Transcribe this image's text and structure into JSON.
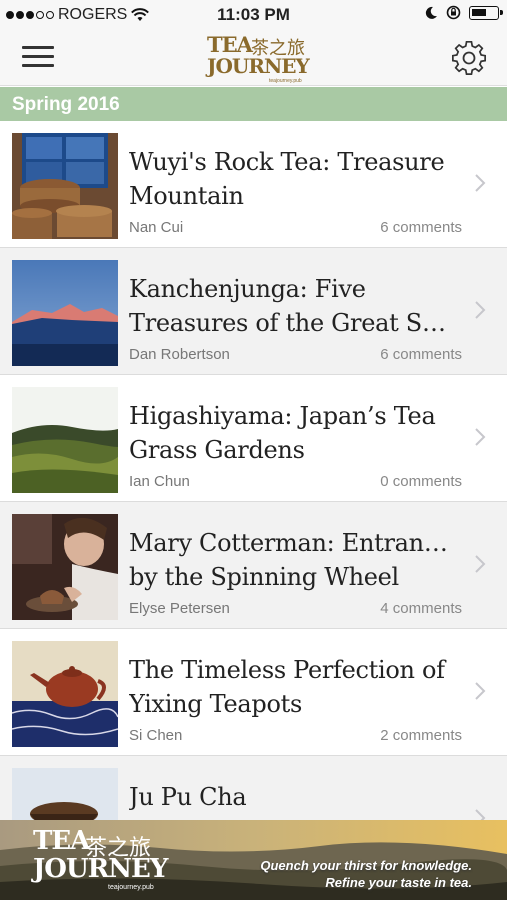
{
  "status_bar": {
    "carrier": "ROGERS",
    "time": "11:03 PM",
    "battery_level": 0.6,
    "signal_bars": 3
  },
  "header": {
    "logo_en_top": "TEA",
    "logo_en_bottom": "JOURNEY",
    "logo_cn": "茶之旅",
    "logo_url": "teajourney.pub"
  },
  "section": {
    "season": "Spring 2016"
  },
  "articles": [
    {
      "title_line1": "Wuyi's Rock Tea: Treasure",
      "title_line2": "Mountain",
      "author": "Nan Cui",
      "comments": "6 comments",
      "thumb_icon": "rock-tea-baskets-thumbnail"
    },
    {
      "title_line1": "Kanchenjunga: Five",
      "title_line2": "Treasures of the Great Sno...",
      "author": "Dan Robertson",
      "comments": "6 comments",
      "thumb_icon": "mountain-sunset-thumbnail"
    },
    {
      "title_line1": "Higashiyama: Japan’s Tea",
      "title_line2": "Grass Gardens",
      "author": "Ian Chun",
      "comments": "0 comments",
      "thumb_icon": "tea-garden-hills-thumbnail"
    },
    {
      "title_line1": "Mary Cotterman: Entranced",
      "title_line2": "by the Spinning Wheel",
      "author": "Elyse Petersen",
      "comments": "4 comments",
      "thumb_icon": "potter-wheel-thumbnail"
    },
    {
      "title_line1": "The Timeless Perfection of",
      "title_line2": "Yixing Teapots",
      "author": "Si Chen",
      "comments": "2 comments",
      "thumb_icon": "yixing-teapot-thumbnail"
    },
    {
      "title_line1": "Ju Pu Cha",
      "title_line2": "",
      "author": "",
      "comments": "",
      "thumb_icon": "tea-bowl-thumbnail"
    }
  ],
  "banner": {
    "logo_en_top": "TEA",
    "logo_en_bottom": "JOURNEY",
    "logo_cn": "茶之旅",
    "logo_url": "teajourney.pub",
    "tagline_1": "Quench your thirst for knowledge.",
    "tagline_2": "Refine your taste in tea."
  },
  "colors": {
    "season_bar": "#a9c9a4",
    "logo_gold": "#8a6a2c",
    "row_alt": "#f2f2f2"
  }
}
